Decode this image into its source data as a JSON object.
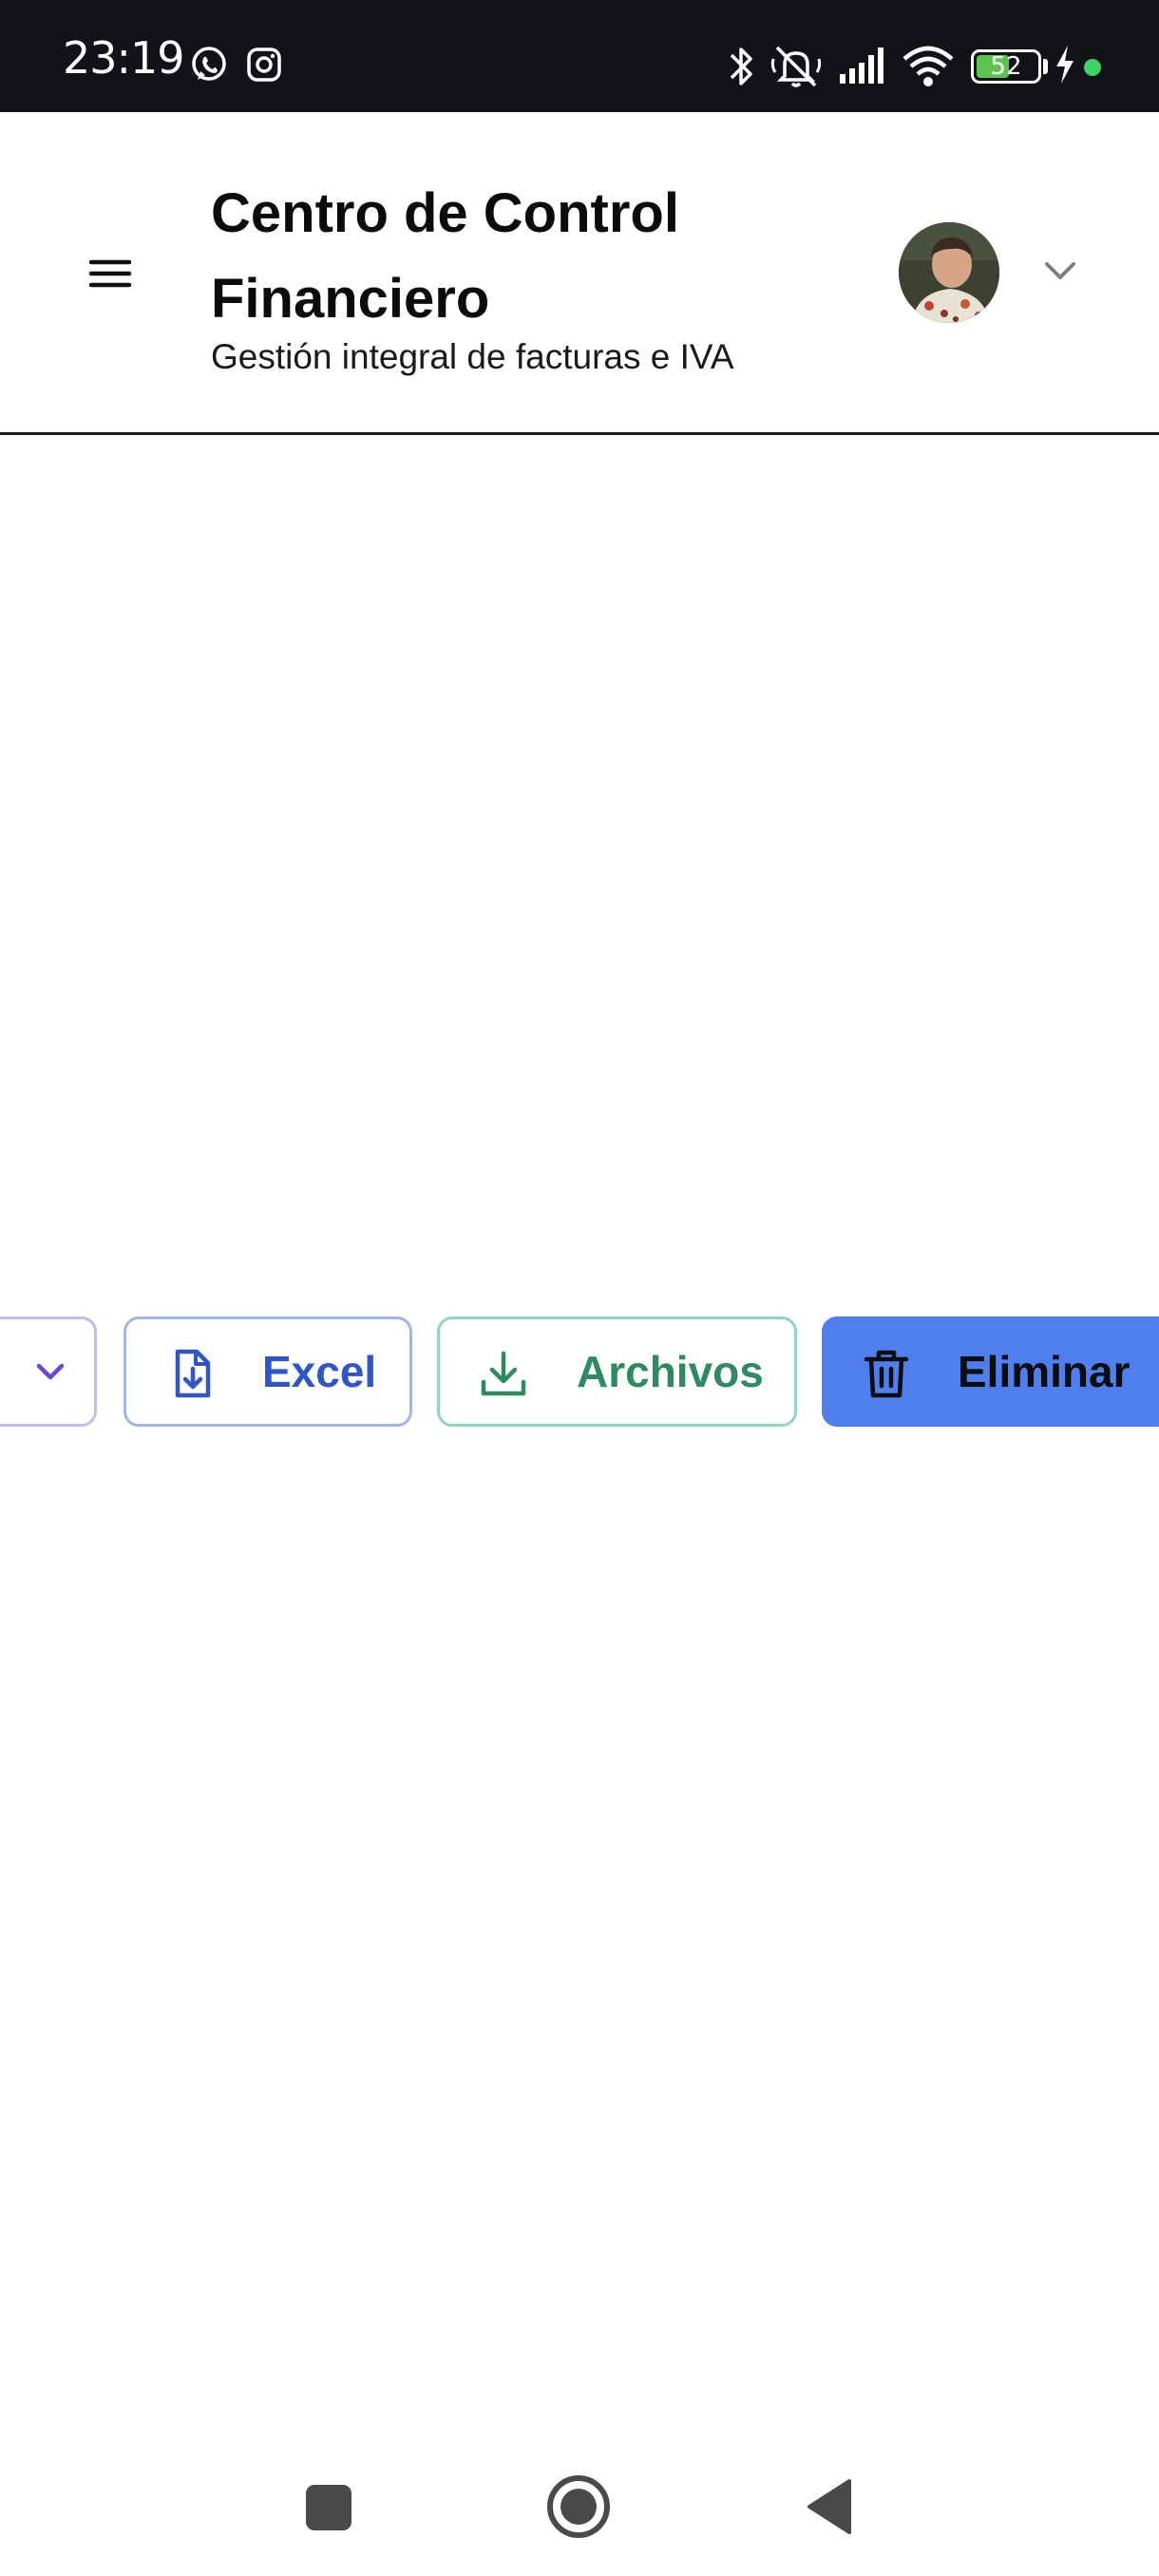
{
  "status_bar": {
    "time": "23:19",
    "battery_level": "52",
    "app_icons": [
      "whatsapp-icon",
      "instagram-icon"
    ],
    "system_icons": [
      "bluetooth-icon",
      "mute-icon",
      "signal-icon",
      "wifi-icon",
      "battery-icon",
      "charging-icon"
    ]
  },
  "header": {
    "title": "Centro de Control Financiero",
    "subtitle": "Gestión integral de facturas e IVA",
    "menu_icon": "hamburger-menu-icon",
    "user_menu_icon": "chevron-down-icon"
  },
  "actions": {
    "more_icon": "chevron-down-icon",
    "excel_label": "Excel",
    "excel_icon": "file-download-icon",
    "archivos_label": "Archivos",
    "archivos_icon": "download-icon",
    "eliminar_label": "Eliminar",
    "eliminar_icon": "trash-icon"
  },
  "navigation": {
    "buttons": [
      "recents-button",
      "home-button",
      "back-button"
    ]
  },
  "colors": {
    "status_bar_bg": "#111318",
    "excel_accent": "#2f55c8",
    "archivos_accent": "#2f8a60",
    "eliminar_bg": "#4f7fee",
    "more_accent": "#6b45d6"
  }
}
